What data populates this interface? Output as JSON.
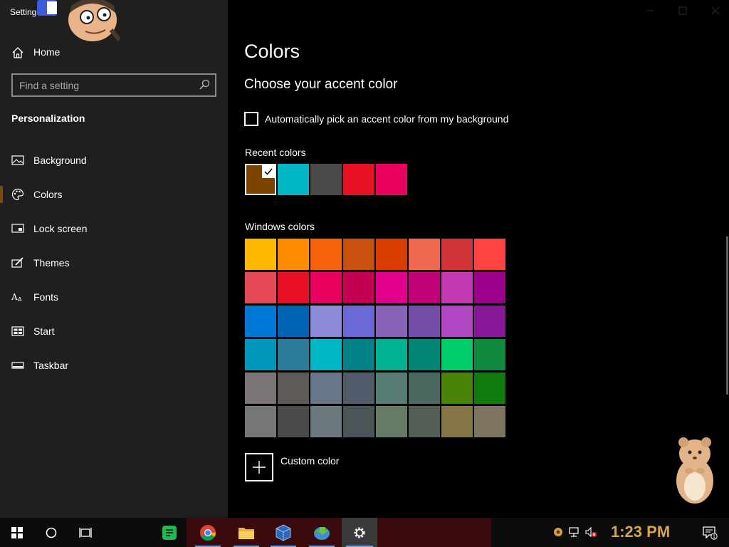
{
  "window": {
    "title": "Settings"
  },
  "sidebar": {
    "home_label": "Home",
    "search_placeholder": "Find a setting",
    "section_heading": "Personalization",
    "items": [
      {
        "label": "Background",
        "icon": "picture-icon"
      },
      {
        "label": "Colors",
        "icon": "palette-icon",
        "active": true
      },
      {
        "label": "Lock screen",
        "icon": "lock-screen-icon"
      },
      {
        "label": "Themes",
        "icon": "brush-icon"
      },
      {
        "label": "Fonts",
        "icon": "fonts-icon"
      },
      {
        "label": "Start",
        "icon": "start-icon"
      },
      {
        "label": "Taskbar",
        "icon": "taskbar-icon"
      }
    ]
  },
  "main": {
    "page_title": "Colors",
    "subtitle": "Choose your accent color",
    "auto_pick_label": "Automatically pick an accent color from my background",
    "auto_pick_checked": false,
    "recent_label": "Recent colors",
    "recent_colors": [
      "#7b4200",
      "#00b7c3",
      "#4c4a48",
      "#e81123",
      "#ea005e"
    ],
    "recent_selected_index": 0,
    "windows_label": "Windows colors",
    "windows_colors": [
      [
        "#ffb900",
        "#ff8c00",
        "#f7630c",
        "#ca5010",
        "#da3b01",
        "#ef6950",
        "#d13438",
        "#ff4343"
      ],
      [
        "#e74856",
        "#e81123",
        "#ea005e",
        "#c30052",
        "#e3008c",
        "#bf0077",
        "#c239b3",
        "#9a0089"
      ],
      [
        "#0078d7",
        "#0063b1",
        "#8e8cd8",
        "#6b69d6",
        "#8764b8",
        "#744da9",
        "#b146c2",
        "#881798"
      ],
      [
        "#0099bc",
        "#2d7d9a",
        "#00b7c3",
        "#038387",
        "#00b294",
        "#018574",
        "#00cc6a",
        "#10893e"
      ],
      [
        "#7a7574",
        "#5d5a58",
        "#68768a",
        "#515c6b",
        "#567c73",
        "#486860",
        "#498205",
        "#107c10"
      ],
      [
        "#767676",
        "#4c4a48",
        "#69797e",
        "#4a5459",
        "#647c64",
        "#525e54",
        "#847545",
        "#7e735f"
      ]
    ],
    "custom_color_label": "Custom color"
  },
  "taskbar": {
    "clock": "1:23 PM",
    "apps": [
      "start-button",
      "cortana-button",
      "task-view-button",
      "green-notes-app",
      "chrome-app",
      "file-explorer-app",
      "virtualbox-app",
      "internet-download-manager-app",
      "settings-app"
    ],
    "tray": [
      "tray-app-icon",
      "network-icon",
      "volume-muted-icon",
      "action-center-icon"
    ],
    "notification_count": "1"
  },
  "colors": {
    "sidebar_bg": "#1f1f1f",
    "main_bg": "#000000",
    "accent": "#7b4200",
    "clock_color": "#d7a44a"
  }
}
